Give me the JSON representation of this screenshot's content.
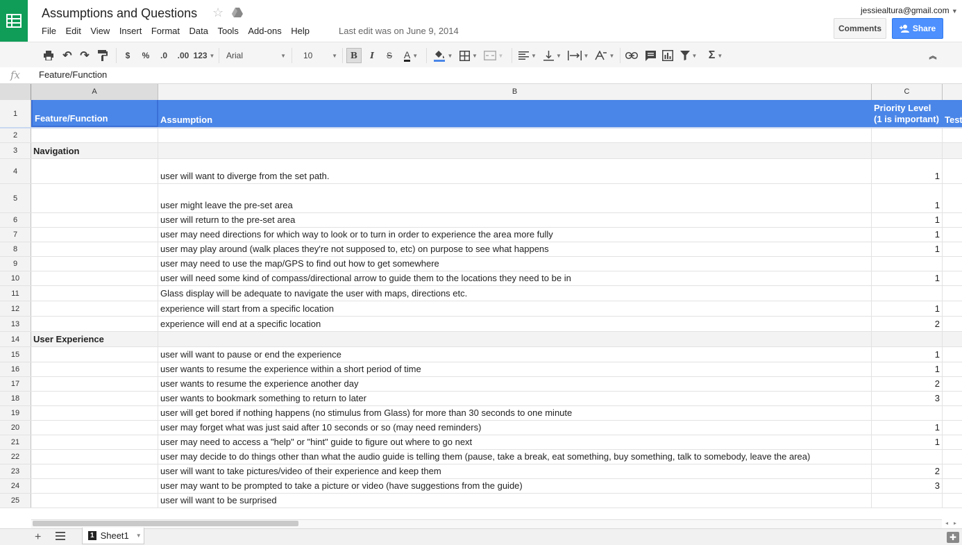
{
  "doc": {
    "title": "Assumptions and Questions",
    "last_edit": "Last edit was on June 9, 2014",
    "user_email": "jessiealtura@gmail.com"
  },
  "menu": [
    "File",
    "Edit",
    "View",
    "Insert",
    "Format",
    "Data",
    "Tools",
    "Add-ons",
    "Help"
  ],
  "buttons": {
    "comments": "Comments",
    "share": "Share"
  },
  "toolbar": {
    "currency": "$",
    "percent": "%",
    "dec_less": ".0",
    "dec_more": ".00",
    "more_formats": "123",
    "font": "Arial",
    "font_size": "10",
    "bold": "B",
    "italic": "I",
    "strike": "S",
    "textcolor": "A"
  },
  "formula_bar": {
    "fx": "fx",
    "content": "Feature/Function"
  },
  "columns": [
    "A",
    "B",
    "C"
  ],
  "header_row": {
    "num": "1",
    "a": "Feature/Function",
    "b": "Assumption",
    "c": "Priority Level (1 is important)",
    "d": "Test"
  },
  "rows": [
    {
      "num": "2",
      "a": "",
      "b": "",
      "c": ""
    },
    {
      "num": "3",
      "a": "Navigation",
      "b": "",
      "c": ""
    },
    {
      "num": "4",
      "a": "",
      "b": "user will want to diverge from the set path.",
      "c": "1"
    },
    {
      "num": "5",
      "a": "",
      "b": "user might leave the pre-set area",
      "c": "1"
    },
    {
      "num": "6",
      "a": "",
      "b": "user will return to the pre-set area",
      "c": "1"
    },
    {
      "num": "7",
      "a": "",
      "b": "user may need directions for which way to look or to turn in order to experience the area more fully",
      "c": "1"
    },
    {
      "num": "8",
      "a": "",
      "b": "user may play around (walk places they're not supposed to, etc) on purpose to see what happens",
      "c": "1"
    },
    {
      "num": "9",
      "a": "",
      "b": "user may need to use the map/GPS to find out how to get somewhere",
      "c": ""
    },
    {
      "num": "10",
      "a": "",
      "b": "user will need some kind of compass/directional arrow to guide them to the locations they need to be in",
      "c": "1"
    },
    {
      "num": "11",
      "a": "",
      "b": "Glass display will be adequate to navigate the user with maps, directions etc.",
      "c": ""
    },
    {
      "num": "12",
      "a": "",
      "b": "experience will start from a specific location",
      "c": "1"
    },
    {
      "num": "13",
      "a": "",
      "b": "experience will end at a specific location",
      "c": "2"
    },
    {
      "num": "14",
      "a": "User Experience",
      "b": "",
      "c": ""
    },
    {
      "num": "15",
      "a": "",
      "b": "user will want to pause or end the experience",
      "c": "1"
    },
    {
      "num": "16",
      "a": "",
      "b": "user wants to resume the experience within a short period of time",
      "c": "1"
    },
    {
      "num": "17",
      "a": "",
      "b": "user wants to resume the experience another day",
      "c": "2"
    },
    {
      "num": "18",
      "a": "",
      "b": "user wants to bookmark something to return to later",
      "c": "3"
    },
    {
      "num": "19",
      "a": "",
      "b": "user will get bored if nothing happens (no stimulus from Glass) for more than 30 seconds to one minute",
      "c": ""
    },
    {
      "num": "20",
      "a": "",
      "b": "user may forget what was just said after 10 seconds or so (may need reminders)",
      "c": "1"
    },
    {
      "num": "21",
      "a": "",
      "b": "user may need to access a \"help\" or \"hint\" guide to figure out where to go next",
      "c": "1"
    },
    {
      "num": "22",
      "a": "",
      "b": "user may decide to do things other than what the audio guide is telling them (pause, take a break, eat something, buy something, talk to somebody, leave the area)",
      "c": ""
    },
    {
      "num": "23",
      "a": "",
      "b": "user will want to take pictures/video of their experience and keep them",
      "c": "2"
    },
    {
      "num": "24",
      "a": "",
      "b": "user may want to be prompted to take a picture or video (have suggestions from the guide)",
      "c": "3"
    },
    {
      "num": "25",
      "a": "",
      "b": "user will want to be surprised",
      "c": ""
    }
  ],
  "sheet": {
    "number": "1",
    "name": "Sheet1"
  },
  "colors": {
    "brand_green": "#0f9d58",
    "header_blue": "#4a86e8",
    "share_blue": "#4d90fe"
  }
}
